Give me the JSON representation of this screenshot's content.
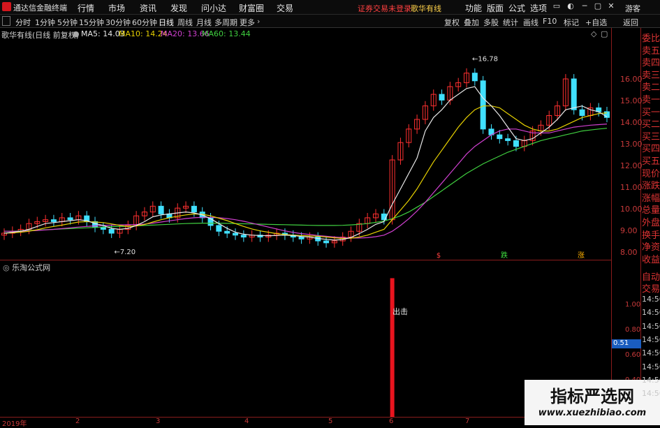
{
  "app": {
    "name": "通达信金融终端",
    "menu": [
      "行情",
      "市场",
      "资讯",
      "发现",
      "问小达",
      "财富圈",
      "交易"
    ],
    "login_status": "证券交易未登录",
    "stock_name": "歌华有线",
    "menu_right": [
      "功能",
      "版面",
      "公式",
      "选项"
    ],
    "guest": "游客"
  },
  "toolbar": {
    "periods": [
      "分时",
      "1分钟",
      "5分钟",
      "15分钟",
      "30分钟",
      "60分钟",
      "日线",
      "周线",
      "月线",
      "多周期",
      "更多"
    ],
    "active_period": "日线",
    "right_tools": [
      "复权",
      "叠加",
      "多股",
      "统计",
      "画线",
      "F10",
      "标记",
      "+自选",
      "返回"
    ]
  },
  "main_chart": {
    "title": "歌华有线(日线 前复权)",
    "ma": [
      {
        "label": "MA5: 14.03",
        "color": "#e8e8e8"
      },
      {
        "label": "MA10: 14.24",
        "color": "#e6d000"
      },
      {
        "label": "MA20: 13.66",
        "color": "#d040d0"
      },
      {
        "label": "MA60: 13.44",
        "color": "#40d040"
      }
    ],
    "price_ticks": [
      "16.00",
      "15.00",
      "14.00",
      "13.00",
      "12.00",
      "11.00",
      "10.00",
      "9.00",
      "8.00"
    ],
    "high_label": "16.78",
    "low_label": "7.20",
    "event_marks": [
      "$",
      "跌",
      "涨"
    ]
  },
  "sub_chart": {
    "title": "乐淘公式网",
    "ticks": [
      "1.00",
      "0.80",
      "0.60",
      "0.40"
    ],
    "current_value": "0.51",
    "signal_label": "出击"
  },
  "date_axis": [
    "2019年",
    "2",
    "3",
    "4",
    "5",
    "6",
    "7",
    "8"
  ],
  "side_labels": [
    "委比",
    "卖五",
    "卖四",
    "卖三",
    "卖二",
    "卖一",
    "买一",
    "买二",
    "买三",
    "买四",
    "买五",
    "现价",
    "涨跌",
    "涨幅",
    "总量",
    "外盘",
    "换手",
    "净资",
    "收益"
  ],
  "side_sub_labels": [
    "自动",
    "交易"
  ],
  "time_items": [
    "14:56",
    "14:56",
    "14:56",
    "14:56",
    "14:56",
    "14:56",
    "14:56",
    "14:56"
  ],
  "watermark": {
    "title": "指标严选网",
    "url": "www.xuezhibiao.com"
  },
  "colors": {
    "up": "#ff3030",
    "down": "#40e0ff",
    "ma5": "#e8e8e8",
    "ma10": "#e6d000",
    "ma20": "#d040d0",
    "ma60": "#40d040",
    "signal": "#e8141e"
  },
  "chart_data": {
    "type": "candlestick",
    "price_range": [
      7.0,
      17.2
    ],
    "close_series": [
      8.0,
      8.1,
      8.2,
      8.5,
      8.6,
      8.7,
      8.6,
      8.8,
      8.7,
      8.9,
      8.6,
      8.3,
      8.2,
      8.0,
      8.2,
      8.4,
      8.9,
      9.1,
      9.4,
      9.0,
      8.8,
      9.3,
      9.4,
      9.1,
      8.8,
      8.4,
      8.1,
      8.0,
      7.9,
      7.8,
      7.9,
      7.8,
      7.9,
      8.0,
      7.9,
      7.8,
      7.7,
      7.8,
      7.6,
      7.5,
      7.6,
      7.8,
      8.1,
      8.5,
      8.8,
      9.0,
      8.7,
      11.8,
      12.7,
      13.4,
      13.9,
      14.6,
      15.2,
      14.9,
      15.6,
      15.8,
      16.3,
      15.9,
      13.4,
      13.1,
      12.9,
      12.8,
      12.5,
      12.8,
      13.3,
      13.6,
      14.1,
      14.6,
      16.0,
      14.4,
      14.1,
      14.5,
      14.3,
      14.0
    ],
    "ma5": [
      8.0,
      8.05,
      8.1,
      8.2,
      8.35,
      8.5,
      8.55,
      8.6,
      8.65,
      8.7,
      8.65,
      8.5,
      8.4,
      8.25,
      8.2,
      8.25,
      8.4,
      8.6,
      8.85,
      8.95,
      9.0,
      9.05,
      9.1,
      9.05,
      8.95,
      8.75,
      8.5,
      8.25,
      8.05,
      7.95,
      7.9,
      7.88,
      7.87,
      7.88,
      7.9,
      7.88,
      7.83,
      7.8,
      7.73,
      7.68,
      7.64,
      7.67,
      7.78,
      7.98,
      8.2,
      8.46,
      8.6,
      9.5,
      10.3,
      11.1,
      11.9,
      13.3,
      14.0,
      14.4,
      14.9,
      15.2,
      15.5,
      15.6,
      15.0,
      14.6,
      14.1,
      13.5,
      12.9,
      12.8,
      12.9,
      13.2,
      13.5,
      13.9,
      14.4,
      14.5,
      14.6,
      14.4,
      14.3,
      14.03
    ],
    "ma10": [
      8.0,
      8.02,
      8.05,
      8.1,
      8.18,
      8.28,
      8.35,
      8.42,
      8.5,
      8.58,
      8.6,
      8.58,
      8.55,
      8.48,
      8.4,
      8.35,
      8.38,
      8.45,
      8.58,
      8.7,
      8.8,
      8.88,
      8.95,
      9.0,
      8.98,
      8.9,
      8.78,
      8.65,
      8.5,
      8.35,
      8.22,
      8.12,
      8.05,
      7.98,
      7.93,
      7.9,
      7.88,
      7.86,
      7.84,
      7.8,
      7.76,
      7.73,
      7.74,
      7.8,
      7.9,
      8.05,
      8.2,
      8.7,
      9.2,
      9.7,
      10.3,
      11.0,
      11.7,
      12.3,
      12.9,
      13.5,
      14.0,
      14.4,
      14.6,
      14.6,
      14.5,
      14.2,
      13.9,
      13.6,
      13.4,
      13.3,
      13.3,
      13.4,
      13.6,
      13.8,
      14.0,
      14.1,
      14.2,
      14.24
    ],
    "ma20": [
      8.1,
      8.1,
      8.1,
      8.12,
      8.14,
      8.17,
      8.2,
      8.24,
      8.28,
      8.32,
      8.35,
      8.38,
      8.4,
      8.42,
      8.43,
      8.44,
      8.45,
      8.47,
      8.52,
      8.58,
      8.64,
      8.7,
      8.76,
      8.8,
      8.82,
      8.82,
      8.8,
      8.76,
      8.7,
      8.62,
      8.52,
      8.42,
      8.32,
      8.22,
      8.12,
      8.04,
      7.98,
      7.93,
      7.88,
      7.84,
      7.8,
      7.77,
      7.75,
      7.75,
      7.77,
      7.82,
      7.9,
      8.1,
      8.4,
      8.75,
      9.15,
      9.6,
      10.1,
      10.6,
      11.1,
      11.6,
      12.1,
      12.5,
      12.8,
      13.1,
      13.3,
      13.4,
      13.4,
      13.3,
      13.2,
      13.2,
      13.2,
      13.3,
      13.4,
      13.5,
      13.55,
      13.6,
      13.63,
      13.66
    ],
    "ma60": [
      8.1,
      8.1,
      8.12,
      8.14,
      8.16,
      8.18,
      8.2,
      8.22,
      8.24,
      8.26,
      8.28,
      8.3,
      8.32,
      8.34,
      8.35,
      8.36,
      8.38,
      8.4,
      8.42,
      8.44,
      8.46,
      8.48,
      8.5,
      8.51,
      8.52,
      8.52,
      8.52,
      8.51,
      8.5,
      8.49,
      8.48,
      8.47,
      8.46,
      8.45,
      8.44,
      8.43,
      8.42,
      8.41,
      8.4,
      8.4,
      8.4,
      8.41,
      8.43,
      8.46,
      8.5,
      8.56,
      8.63,
      8.75,
      8.9,
      9.1,
      9.35,
      9.6,
      9.9,
      10.2,
      10.5,
      10.8,
      11.1,
      11.35,
      11.6,
      11.8,
      12.0,
      12.2,
      12.35,
      12.5,
      12.65,
      12.8,
      12.9,
      13.0,
      13.1,
      13.2,
      13.3,
      13.35,
      13.4,
      13.44
    ],
    "signal": {
      "index": 47,
      "value": 1.1
    },
    "sub_range": [
      0.3,
      1.15
    ]
  }
}
